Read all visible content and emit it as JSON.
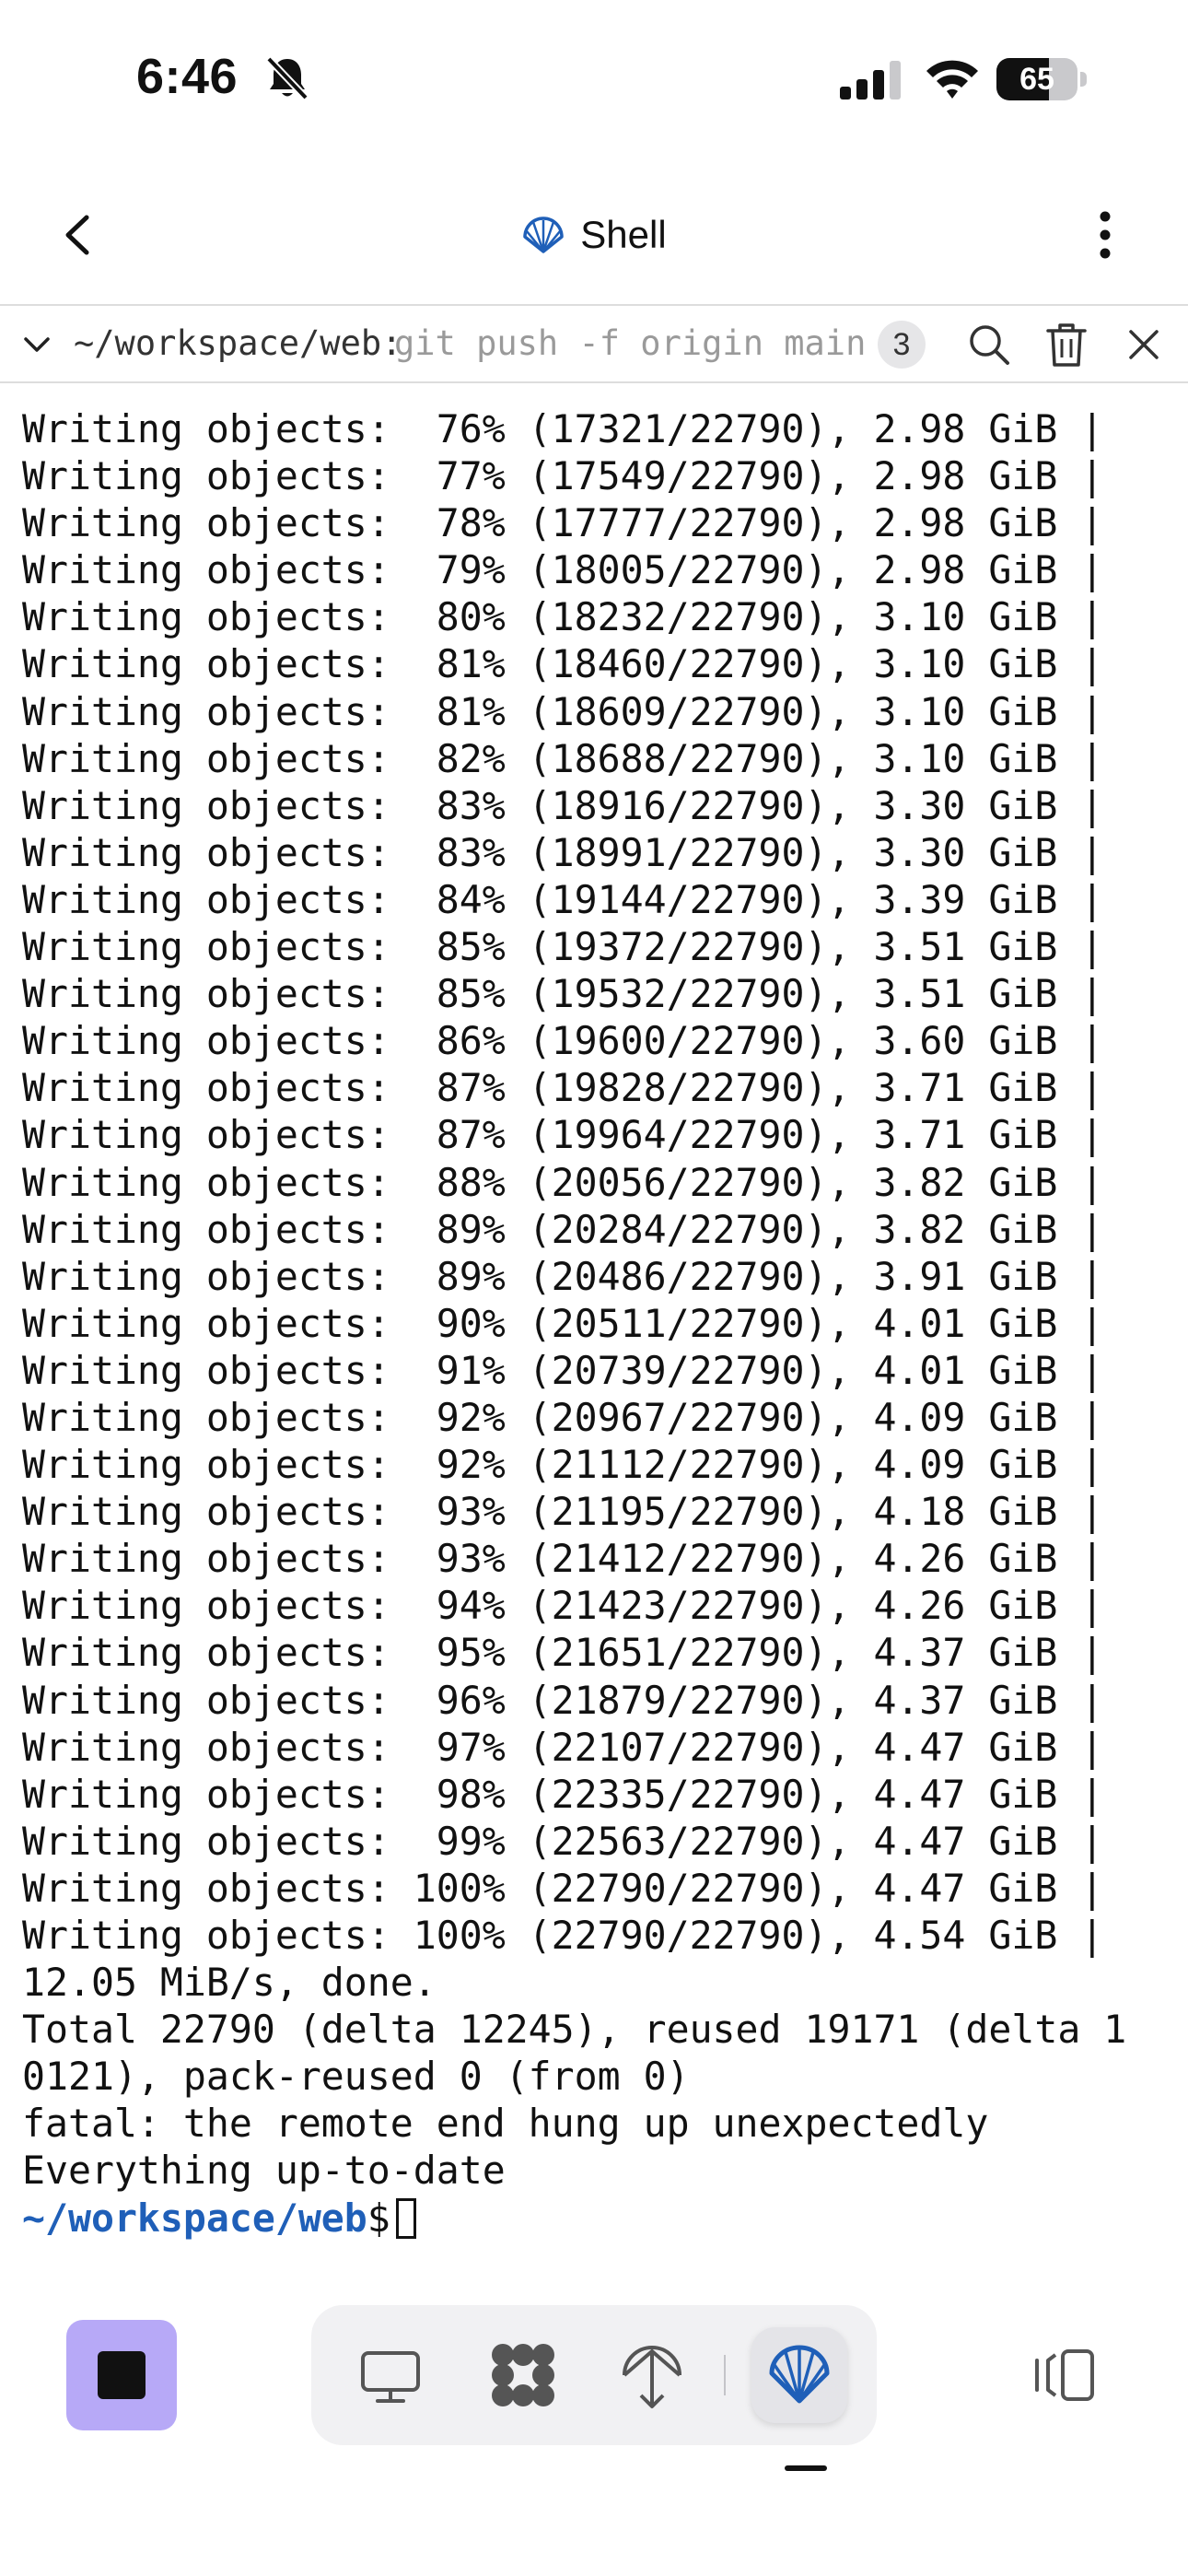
{
  "status_bar": {
    "time": "6:46",
    "battery_level": "65",
    "battery_fraction": 0.65,
    "icons": [
      "bell-slash-icon",
      "signal-icon",
      "wifi-icon",
      "battery-icon"
    ]
  },
  "header": {
    "title": "Shell",
    "title_icon": "shell-icon",
    "back_icon": "chevron-left-icon",
    "more_icon": "more-vertical-icon"
  },
  "command_bar": {
    "cwd": "~/workspace/web:",
    "command": "git push -f origin main",
    "count": "3",
    "icons": [
      "chevron-down-icon",
      "search-icon",
      "trash-icon",
      "close-icon"
    ]
  },
  "terminal": {
    "lines": [
      "Writing objects:  76% (17321/22790), 2.98 GiB |",
      "Writing objects:  77% (17549/22790), 2.98 GiB |",
      "Writing objects:  78% (17777/22790), 2.98 GiB |",
      "Writing objects:  79% (18005/22790), 2.98 GiB |",
      "Writing objects:  80% (18232/22790), 3.10 GiB |",
      "Writing objects:  81% (18460/22790), 3.10 GiB |",
      "Writing objects:  81% (18609/22790), 3.10 GiB |",
      "Writing objects:  82% (18688/22790), 3.10 GiB |",
      "Writing objects:  83% (18916/22790), 3.30 GiB |",
      "Writing objects:  83% (18991/22790), 3.30 GiB |",
      "Writing objects:  84% (19144/22790), 3.39 GiB |",
      "Writing objects:  85% (19372/22790), 3.51 GiB |",
      "Writing objects:  85% (19532/22790), 3.51 GiB |",
      "Writing objects:  86% (19600/22790), 3.60 GiB |",
      "Writing objects:  87% (19828/22790), 3.71 GiB |",
      "Writing objects:  87% (19964/22790), 3.71 GiB |",
      "Writing objects:  88% (20056/22790), 3.82 GiB |",
      "Writing objects:  89% (20284/22790), 3.82 GiB |",
      "Writing objects:  89% (20486/22790), 3.91 GiB |",
      "Writing objects:  90% (20511/22790), 4.01 GiB |",
      "Writing objects:  91% (20739/22790), 4.01 GiB |",
      "Writing objects:  92% (20967/22790), 4.09 GiB |",
      "Writing objects:  92% (21112/22790), 4.09 GiB |",
      "Writing objects:  93% (21195/22790), 4.18 GiB |",
      "Writing objects:  93% (21412/22790), 4.26 GiB |",
      "Writing objects:  94% (21423/22790), 4.26 GiB |",
      "Writing objects:  95% (21651/22790), 4.37 GiB |",
      "Writing objects:  96% (21879/22790), 4.37 GiB |",
      "Writing objects:  97% (22107/22790), 4.47 GiB |",
      "Writing objects:  98% (22335/22790), 4.47 GiB |",
      "Writing objects:  99% (22563/22790), 4.47 GiB |",
      "Writing objects: 100% (22790/22790), 4.47 GiB |",
      "Writing objects: 100% (22790/22790), 4.54 GiB |",
      "12.05 MiB/s, done.",
      "Total 22790 (delta 12245), reused 19171 (delta 1",
      "0121), pack-reused 0 (from 0)",
      "fatal: the remote end hung up unexpectedly",
      "Everything up-to-date"
    ],
    "prompt_path": "~/workspace/web",
    "prompt_symbol": "$"
  },
  "bottom_bar": {
    "stop_icon": "stop-icon",
    "tabs": [
      {
        "icon": "desktop-icon",
        "active": false
      },
      {
        "icon": "apps-grid-icon",
        "active": false
      },
      {
        "icon": "antenna-icon",
        "active": false
      },
      {
        "icon": "shell-icon",
        "active": true
      }
    ],
    "split_icon": "split-view-icon",
    "colors": {
      "stop_button": "#b7a9f7",
      "accent": "#1f5fb8"
    }
  }
}
